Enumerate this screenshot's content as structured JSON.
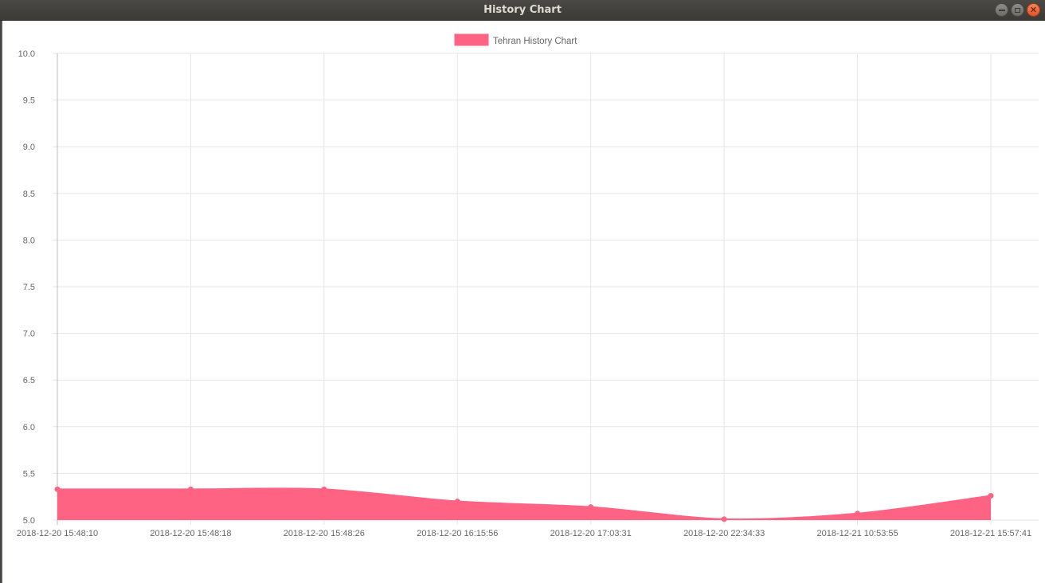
{
  "window": {
    "title": "History Chart"
  },
  "chart_data": {
    "type": "area",
    "x": [
      "2018-12-20 15:48:10",
      "2018-12-20 15:48:18",
      "2018-12-20 15:48:26",
      "2018-12-20 16:15:56",
      "2018-12-20 17:03:31",
      "2018-12-20 22:34:33",
      "2018-12-21 10:53:55",
      "2018-12-21 15:57:41"
    ],
    "series": [
      {
        "name": "Tehran History Chart",
        "values": [
          5.33,
          5.33,
          5.33,
          5.2,
          5.14,
          5.01,
          5.07,
          5.26
        ],
        "color": "#ff6384"
      }
    ],
    "ylim": [
      5.0,
      10.0
    ],
    "yticks": [
      "5.0",
      "5.5",
      "6.0",
      "6.5",
      "7.0",
      "7.5",
      "8.0",
      "8.5",
      "9.0",
      "9.5",
      "10.0"
    ],
    "legend": "top-center",
    "grid": true
  }
}
